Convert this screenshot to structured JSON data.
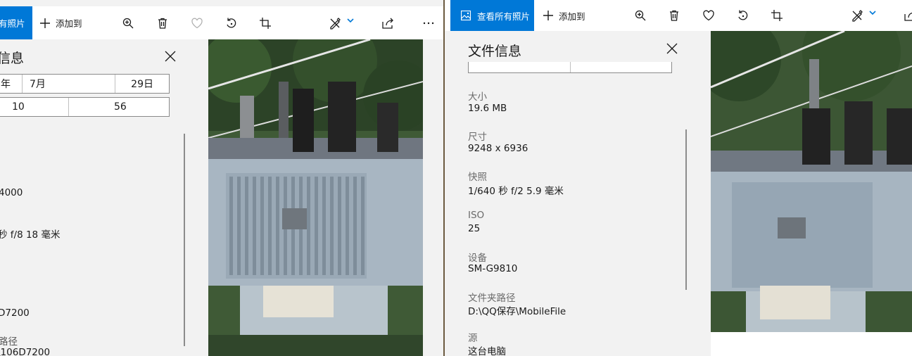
{
  "left": {
    "toolbar": {
      "view_all": "有照片",
      "add_to": "添加到"
    },
    "panel": {
      "title": "信息",
      "date_fields": [
        "年",
        "7月",
        "29日"
      ],
      "time_fields": [
        "10",
        "56"
      ],
      "rows": [
        {
          "label": "",
          "value": ""
        },
        {
          "label": "",
          "value": "4000"
        },
        {
          "label": "",
          "value": "秒 f/8 18 毫米"
        },
        {
          "label": "",
          "value": ""
        },
        {
          "label": "",
          "value": "D7200"
        },
        {
          "label": "路径",
          "value": "\\106D7200"
        }
      ]
    }
  },
  "right": {
    "toolbar": {
      "view_all": "查看所有照片",
      "add_to": "添加到"
    },
    "panel": {
      "title": "文件信息",
      "rows": [
        {
          "label": "大小",
          "value": "19.6 MB"
        },
        {
          "label": "尺寸",
          "value": "9248 x 6936"
        },
        {
          "label": "快照",
          "value": "1/640 秒 f/2 5.9 毫米"
        },
        {
          "label": "ISO",
          "value": "25"
        },
        {
          "label": "设备",
          "value": "SM-G9810"
        },
        {
          "label": "文件夹路径",
          "value": "D:\\QQ保存\\MobileFile"
        },
        {
          "label": "源",
          "value": "这台电脑"
        }
      ]
    }
  },
  "icons": {
    "zoom": "zoom-in-icon",
    "delete": "trash-icon",
    "favorite": "heart-icon",
    "rotate": "rotate-icon",
    "crop": "crop-icon",
    "edit": "edit-pen-icon",
    "share": "share-icon",
    "more": "more-icon",
    "close": "close-icon",
    "photos": "photos-app-icon",
    "plus": "plus-icon"
  },
  "colors": {
    "accent": "#0078d7"
  }
}
